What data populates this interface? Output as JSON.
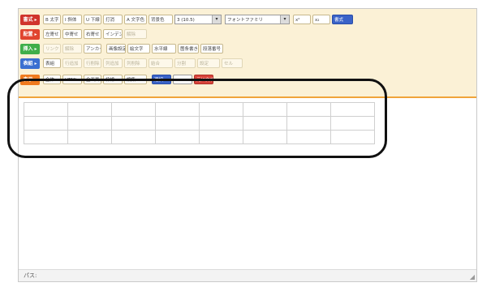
{
  "toolbar": {
    "rows": [
      {
        "category": "書式",
        "color": "#d0342c",
        "buttons": [
          {
            "label": "B 太字",
            "disabled": false
          },
          {
            "label": "I 斜体",
            "disabled": false
          },
          {
            "label": "U 下線",
            "disabled": false
          },
          {
            "label": "打消",
            "disabled": false
          },
          {
            "label": "A 文字色",
            "disabled": false
          },
          {
            "label": "背景色",
            "disabled": false
          }
        ],
        "selects": [
          {
            "value": "3 (10.5)"
          },
          {
            "value": "フォントファミリ"
          }
        ],
        "extra": [
          {
            "label": "x²",
            "disabled": false
          },
          {
            "label": "x₂",
            "disabled": false
          },
          {
            "label": "書式",
            "style": "blue"
          }
        ]
      },
      {
        "category": "配置",
        "color": "#e0442f",
        "buttons": [
          {
            "label": "左寄せ",
            "disabled": false
          },
          {
            "label": "中寄せ",
            "disabled": false
          },
          {
            "label": "右寄せ",
            "disabled": false
          },
          {
            "label": "インデント",
            "disabled": false
          },
          {
            "label": "解除",
            "disabled": true
          }
        ]
      },
      {
        "category": "挿入",
        "color": "#3fae4a",
        "buttons": [
          {
            "label": "リンク",
            "disabled": true
          },
          {
            "label": "解除",
            "disabled": true
          },
          {
            "label": "アンカー",
            "disabled": false
          },
          {
            "label": "画像設定",
            "disabled": false
          },
          {
            "label": "絵文字",
            "disabled": false
          },
          {
            "label": "水平線",
            "disabled": false
          },
          {
            "label": "箇条書き",
            "disabled": false
          },
          {
            "label": "段落番号",
            "disabled": false
          }
        ]
      },
      {
        "category": "表組",
        "color": "#3a6fd1",
        "buttons": [
          {
            "label": "表組",
            "disabled": false
          },
          {
            "label": "行追加",
            "disabled": true
          },
          {
            "label": "行削除",
            "disabled": true
          },
          {
            "label": "列追加",
            "disabled": true
          },
          {
            "label": "列削除",
            "disabled": true
          },
          {
            "label": "結合",
            "disabled": true
          },
          {
            "label": "分割",
            "disabled": true
          },
          {
            "label": "設定",
            "disabled": true
          },
          {
            "label": "セル",
            "disabled": true
          }
        ]
      },
      {
        "category": "表示",
        "color": "#f07a1f",
        "buttons": [
          {
            "label": "全体",
            "disabled": false
          },
          {
            "label": "HTML",
            "disabled": false
          },
          {
            "label": "全画面",
            "disabled": false
          },
          {
            "label": "枠線",
            "disabled": false
          },
          {
            "label": "編集",
            "disabled": false
          },
          {
            "label": "選択",
            "style": "blue"
          },
          {
            "label": "",
            "style": "white"
          },
          {
            "label": "元に戻す",
            "style": "red"
          }
        ]
      }
    ]
  },
  "table": {
    "rows": 3,
    "cols": 8
  },
  "statusbar": {
    "path": "パス:"
  }
}
